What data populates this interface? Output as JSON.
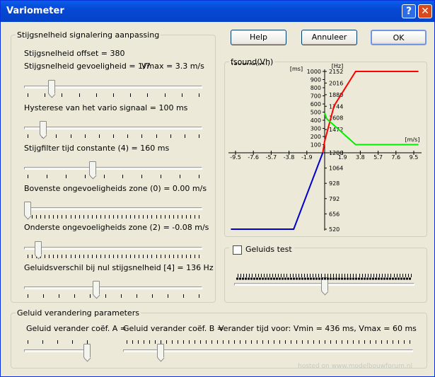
{
  "window": {
    "title": "Variometer",
    "help_glyph": "?",
    "close_glyph": "✕"
  },
  "buttons": {
    "help": "Help",
    "cancel": "Annuleer",
    "ok": "OK"
  },
  "signal_group": {
    "legend": "Stijgsnelheid signalering aanpassing",
    "offset_label": "Stijgsnelheid offset = 380",
    "sensitivity_label": "Stijgsnelheid gevoeligheid = 1/7",
    "vmax_label": "Vmax = 3.3 m/s",
    "hysteresis_label": "Hysterese van het vario signaal = 100 ms",
    "filter_label": "Stijgfilter tijd constante (4) = 160 ms",
    "upper_zone_label": "Bovenste ongevoeligheids zone (0) = 0.00 m/s",
    "lower_zone_label": "Onderste ongevoeligheids zone (2) = -0.08 m/s",
    "sound_diff_label": "Geluidsverschil bij nul stijgsnelheid [4] = 136 Hz"
  },
  "sliders": {
    "sensitivity": {
      "value": 0.14
    },
    "hysteresis": {
      "value": 0.09
    },
    "filter": {
      "value": 0.38
    },
    "upper_zone": {
      "value": 0.0
    },
    "lower_zone": {
      "value": 0.06
    },
    "sound_diff": {
      "value": 0.4
    },
    "test": {
      "value": 0.5
    },
    "coef_a": {
      "value": 1.0
    },
    "coef_b": {
      "value": 0.12
    }
  },
  "chart_group": {
    "legend": "fsound(Vh)"
  },
  "chart_data": {
    "type": "line",
    "title": "fsound(Vh)",
    "x_unit": "[m/s]",
    "y_unit_left": "[ms]",
    "y_unit_right": "[Hz]",
    "x_ticks": [
      "-9.5",
      "-7.6",
      "-5.7",
      "-3.8",
      "-1.9",
      "1.9",
      "3.8",
      "5.7",
      "7.6",
      "9.5"
    ],
    "x_tick_values": [
      -9.5,
      -7.6,
      -5.7,
      -3.8,
      -1.9,
      1.9,
      3.8,
      5.7,
      7.6,
      9.5
    ],
    "y_ticks_ms": [
      "1000",
      "900",
      "800",
      "700",
      "600",
      "500",
      "400",
      "300",
      "200",
      "100"
    ],
    "y_ticks_ms_values": [
      1000,
      900,
      800,
      700,
      600,
      500,
      400,
      300,
      200,
      100
    ],
    "y_ticks_hz": [
      "2152",
      "2016",
      "1880",
      "1744",
      "1608",
      "1472",
      "1200",
      "1064",
      "928",
      "792",
      "656",
      "520"
    ],
    "y_ticks_hz_values": [
      2152,
      2016,
      1880,
      1744,
      1608,
      1472,
      1200,
      1064,
      928,
      792,
      656,
      520
    ],
    "xlim": [
      -10,
      10
    ],
    "ylim_hz": [
      520,
      2152
    ],
    "ylim_ms": [
      0,
      1000
    ],
    "series": [
      {
        "color": "#FF0000",
        "axis": "hz",
        "points": [
          [
            -0.2,
            1200
          ],
          [
            0,
            1336
          ],
          [
            1.0,
            1750
          ],
          [
            3.3,
            2152
          ],
          [
            10,
            2152
          ]
        ]
      },
      {
        "color": "#0000CC",
        "axis": "hz",
        "points": [
          [
            -10,
            520
          ],
          [
            -3.3,
            520
          ],
          [
            -0.2,
            1200
          ]
        ]
      },
      {
        "color": "#00EE00",
        "axis": "ms",
        "points": [
          [
            0,
            490
          ],
          [
            0.2,
            420
          ],
          [
            3.3,
            100
          ],
          [
            10,
            100
          ]
        ]
      }
    ]
  },
  "test_group": {
    "legend": "Geluids test"
  },
  "sound_group": {
    "legend": "Geluid verandering parameters",
    "coef_a_label": "Geluid verander coëf. A =",
    "coef_b_label": "Geluid verander coëf. B =",
    "time_label": "Verander tijd voor: Vmin = 436 ms, Vmax = 60 ms"
  },
  "watermark": "hosted on www.modelbouwforum.nl"
}
